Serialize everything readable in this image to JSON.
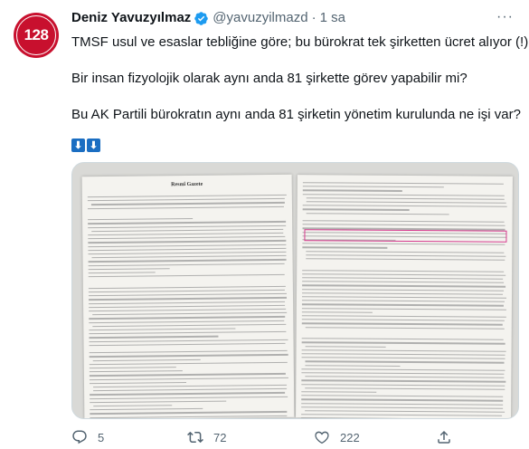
{
  "author": {
    "avatar_text": "128",
    "name": "Deniz Yavuzyılmaz",
    "handle": "@yavuzyilmazd",
    "time": "1 sa",
    "brand_color": "#c8102e"
  },
  "tweet": {
    "lines": [
      "TMSF usul ve esaslar tebliğine göre; bu bürokrat tek şirketten ücret alıyor (!)",
      "Bir insan fizyolojik olarak aynı anda 81 şirkette görev yapabilir mi?",
      "Bu AK Partili bürokratın aynı anda 81 şirketin yönetim kurulunda ne işi var?"
    ],
    "emojis": [
      "⬇",
      "⬇"
    ]
  },
  "media": {
    "gazette_name": "Resmî Gazete",
    "highlight_color": "#d63b8e"
  },
  "actions": {
    "reply_count": "5",
    "retweet_count": "72",
    "like_count": "222",
    "icons": [
      "reply-icon",
      "retweet-icon",
      "like-icon",
      "share-icon"
    ]
  }
}
